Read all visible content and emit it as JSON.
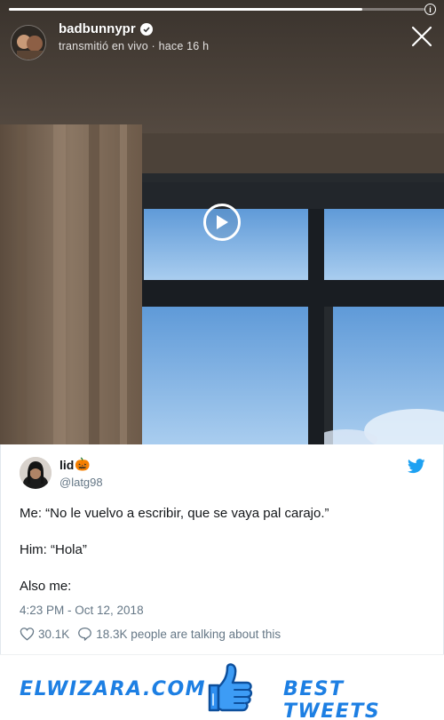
{
  "story": {
    "username": "badbunnypr",
    "subtitle": "transmitió en vivo · hace 16 h",
    "progress": 0.85,
    "colors": {
      "sky": "#8fc0ec",
      "frame": "#161a1f",
      "curtain": "#7d6a58",
      "ceiling": "#54483f"
    }
  },
  "tweet": {
    "name": "lid",
    "name_emoji": "🎃",
    "handle": "@latg98",
    "lines": [
      "Me: “No le vuelvo a escribir, que se vaya pal carajo.”",
      "Him: “Hola”",
      "Also me:"
    ],
    "timestamp": "4:23 PM - Oct 12, 2018",
    "likes": "30.1K",
    "replies": "18.3K people are talking about this",
    "colors": {
      "accent": "#1da1f2",
      "muted": "#657786"
    }
  },
  "footer": {
    "brand": "ELWIZARA.COM",
    "tagline": "BEST TWEETS",
    "color": "#1d7fe3"
  }
}
